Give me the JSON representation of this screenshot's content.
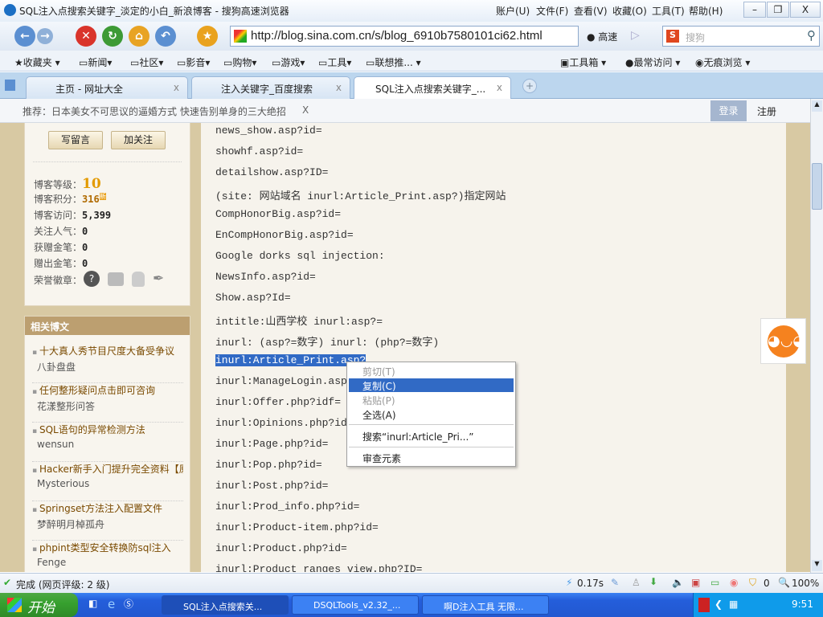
{
  "window": {
    "title": "SQL注入点搜索关键字_淡定的小白_新浪博客 - 搜狗高速浏览器",
    "menus": [
      "账户(U)",
      "文件(F)",
      "查看(V)",
      "收藏(O)",
      "工具(T)",
      "帮助(H)"
    ],
    "controls": {
      "minimize": "–",
      "restore": "❐",
      "close": "X"
    }
  },
  "nav": {
    "url": "http://blog.sina.com.cn/s/blog_6910b7580101ci62.html",
    "speed_label": "高速",
    "search_placeholder": "搜狗"
  },
  "bookmarks": {
    "left": [
      "收藏夹",
      "新闻",
      "社区",
      "影音",
      "购物",
      "游戏",
      "工具",
      "联想推..."
    ],
    "right": [
      "工具箱",
      "最常访问",
      "无痕浏览"
    ]
  },
  "tabs": [
    {
      "label": "主页 - 网址大全"
    },
    {
      "label": "注入关键字_百度搜索"
    },
    {
      "label": "SQL注入点搜索关键字_..."
    }
  ],
  "infobar": {
    "recommend": "推荐：日本美女不可思议的逼婚方式   快速告别单身的三大绝招",
    "close": "X",
    "login": "登录",
    "register": "注册"
  },
  "sidebar": {
    "buttons": [
      "写留言",
      "加关注"
    ],
    "stats": [
      {
        "label": "博客等级：",
        "value": "10"
      },
      {
        "label": "博客积分：",
        "value": "316"
      },
      {
        "label": "博客访问：",
        "value": "5,399"
      },
      {
        "label": "关注人气：",
        "value": "0"
      },
      {
        "label": "获赠金笔：",
        "value": "0"
      },
      {
        "label": "赠出金笔：",
        "value": "0"
      },
      {
        "label": "荣誉徽章：",
        "value": ""
      }
    ],
    "new_badge": "新",
    "related_title": "相关博文",
    "related": [
      {
        "title": "十大真人秀节目尺度大备受争议",
        "author": "八卦盘盘"
      },
      {
        "title": "任何整形疑问点击即可咨询",
        "author": "花漾整形问答"
      },
      {
        "title": "SQL语句的异常检测方法",
        "author": "wensun"
      },
      {
        "title": "Hacker新手入门提升完全资料【原创",
        "author": "Mysterious"
      },
      {
        "title": "Springset方法注入配置文件",
        "author": "梦醉明月棹孤舟"
      },
      {
        "title": "phpint类型安全转换防sql注入",
        "author": "Fenge"
      }
    ]
  },
  "article": {
    "lines": [
      "news_show.asp?id=",
      "showhf.asp?id=",
      "detailshow.asp?ID=",
      "(site: 网站域名 inurl:Article_Print.asp?)指定网站",
      "CompHonorBig.asp?id=",
      "EnCompHonorBig.asp?id=",
      "Google dorks sql injection:",
      "NewsInfo.asp?id=",
      "Show.asp?Id=",
      "intitle:山西学校 inurl:asp?=",
      "inurl: (asp?=数字) inurl: (php?=数字)",
      "inurl:Article_Print.asp?",
      "inurl:ManageLogin.asp",
      "inurl:Offer.php?idf=",
      "inurl:Opinions.php?id=",
      "inurl:Page.php?id=",
      "inurl:Pop.php?id=",
      "inurl:Post.php?id=",
      "inurl:Prod_info.php?id=",
      "inurl:Product-item.php?id=",
      "inurl:Product.php?id=",
      "inurl:Product_ranges_view.php?ID="
    ],
    "selected_index": 11
  },
  "context_menu": {
    "items": [
      {
        "label": "剪切(T)",
        "disabled": true
      },
      {
        "label": "复制(C)",
        "highlighted": true
      },
      {
        "label": "粘贴(P)",
        "disabled": true
      },
      {
        "label": "全选(A)"
      },
      {
        "label": "搜索“inurl:Article_Pri...”"
      },
      {
        "label": "审查元素"
      }
    ]
  },
  "status": {
    "text": "完成 (网页评级: 2 级)",
    "time": "0.17s",
    "counter": "0",
    "zoom": "100%"
  },
  "taskbar": {
    "start": "开始",
    "tasks": [
      "SQL注入点搜索关...",
      "DSQLTools_v2.32_...",
      "啊D注入工具 无限..."
    ],
    "clock": "9:51"
  }
}
